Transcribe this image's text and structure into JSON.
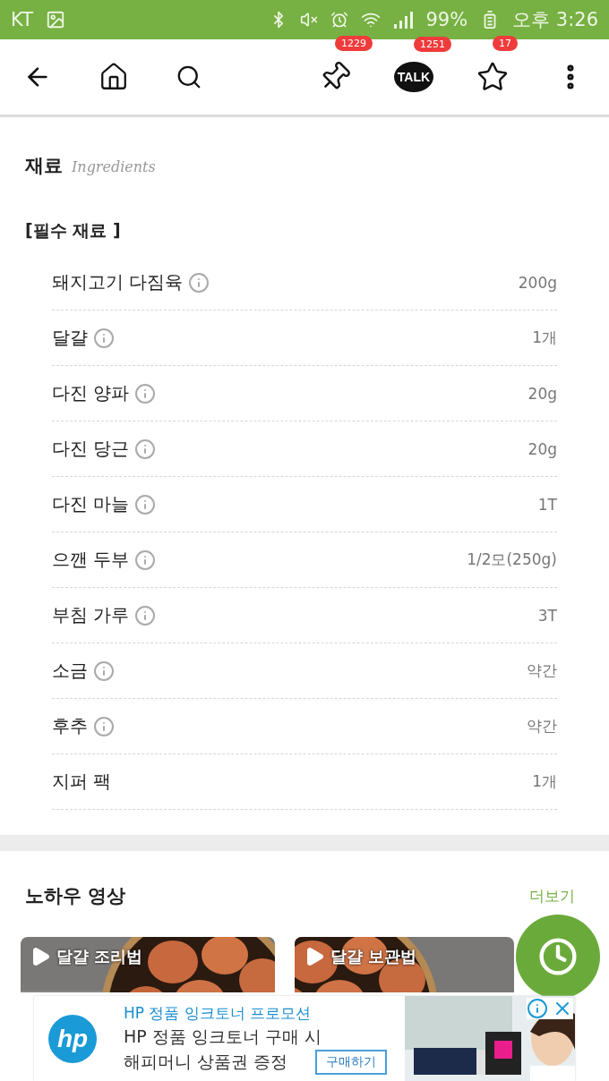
{
  "status_bar": {
    "carrier": "KT",
    "battery": "99%",
    "time": "오후 3:26"
  },
  "toolbar": {
    "actions": [
      {
        "kind": "pin",
        "badge": "1229"
      },
      {
        "kind": "talk",
        "label": "TALK",
        "badge": "1251"
      },
      {
        "kind": "star",
        "badge": "17"
      }
    ]
  },
  "ingredients": {
    "title": "재료",
    "subtitle": "Ingredients",
    "group": "[필수 재료 ]",
    "items": [
      {
        "name": "돼지고기 다짐육",
        "has_info": true,
        "amount": "200g"
      },
      {
        "name": "달걀",
        "has_info": true,
        "amount": "1개"
      },
      {
        "name": "다진 양파",
        "has_info": true,
        "amount": "20g"
      },
      {
        "name": "다진 당근",
        "has_info": true,
        "amount": "20g"
      },
      {
        "name": "다진 마늘",
        "has_info": true,
        "amount": "1T"
      },
      {
        "name": "으깬 두부",
        "has_info": true,
        "amount": "1/2모(250g)"
      },
      {
        "name": "부침 가루",
        "has_info": true,
        "amount": "3T"
      },
      {
        "name": "소금",
        "has_info": true,
        "amount": "약간"
      },
      {
        "name": "후추",
        "has_info": true,
        "amount": "약간"
      },
      {
        "name": "지퍼 팩",
        "has_info": false,
        "amount": "1개"
      }
    ]
  },
  "videos": {
    "title": "노하우 영상",
    "more": "더보기",
    "cards": [
      {
        "title": "달걀 조리법"
      },
      {
        "title": "달걀 보관법"
      }
    ]
  },
  "ad": {
    "logo": "hp",
    "headline": "HP 정품 잉크토너 프로모션",
    "lines": [
      "HP 정품 잉크토너 구매 시",
      "해피머니 상품권 증정"
    ],
    "button": "구매하기"
  }
}
